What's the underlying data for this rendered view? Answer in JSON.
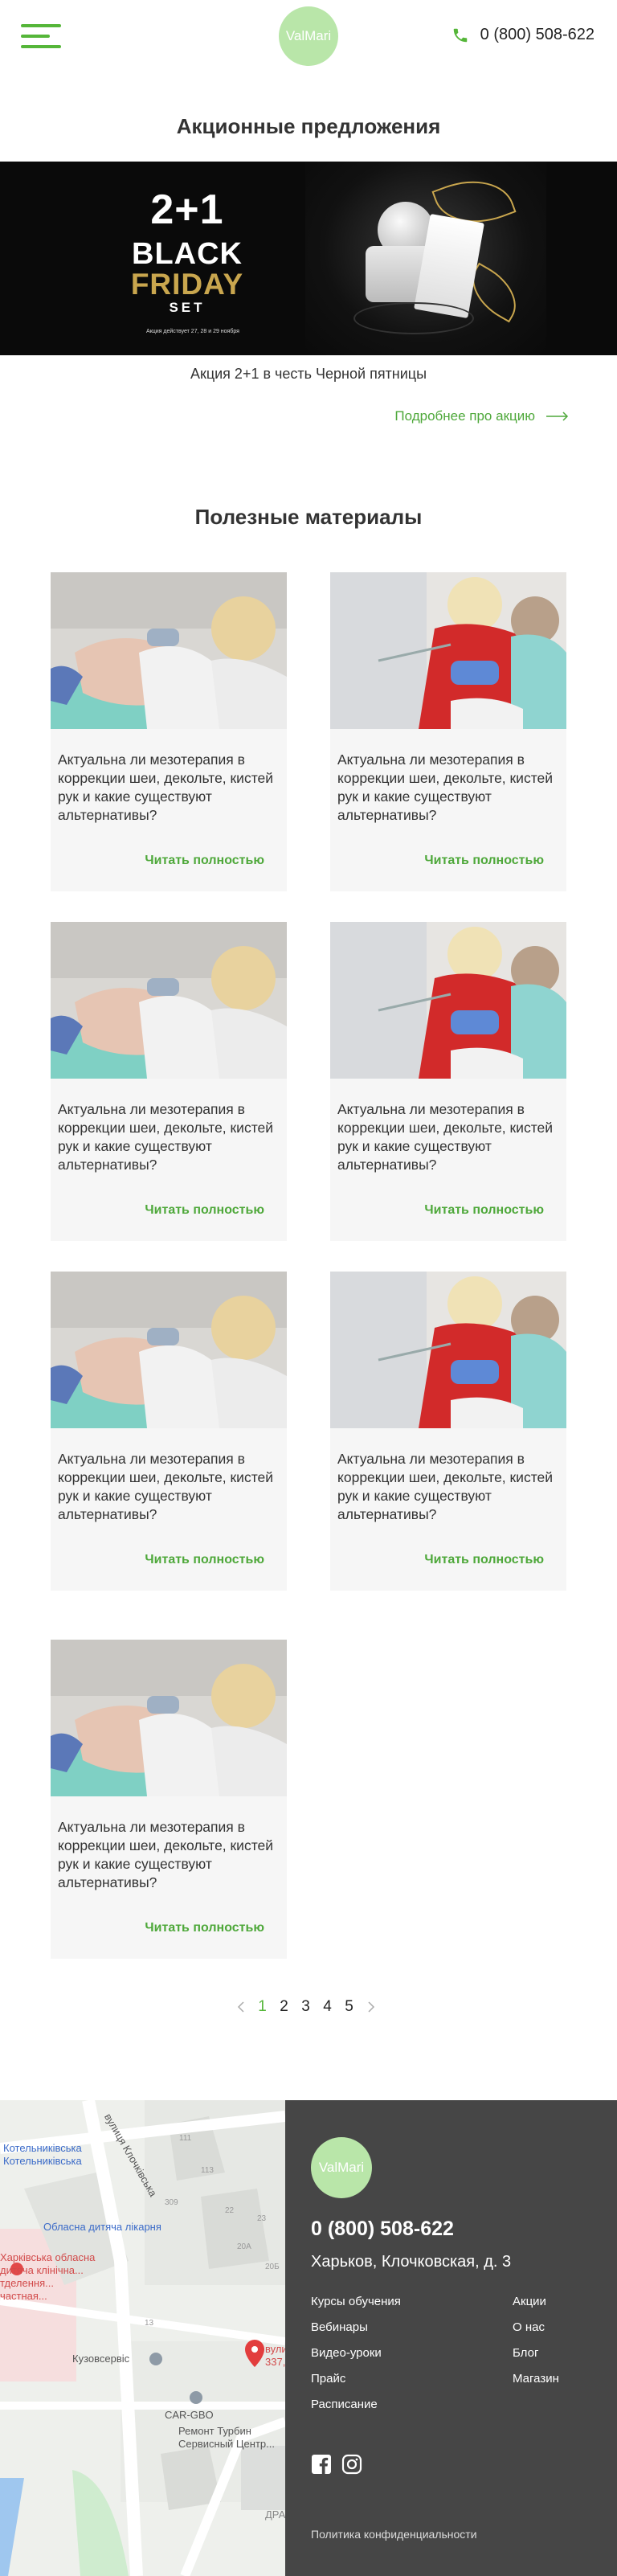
{
  "header": {
    "logo_text": "ValMari",
    "phone": "0 (800) 508-622",
    "accent_color": "#55b639"
  },
  "promo": {
    "title": "Акционные предложения",
    "banner": {
      "line1": "2+1",
      "line2": "BLACK",
      "line3": "FRIDAY",
      "line4": "SET",
      "small": "Акция действует 27, 28 и 29 ноября"
    },
    "caption": "Акция 2+1 в честь Черной пятницы",
    "link_label": "Подробнее про акцию"
  },
  "materials": {
    "title": "Полезные материалы",
    "cards": [
      {
        "text": "Актуальна ли мезотерапия в коррекции шеи, декольте, кистей рук и какие существуют альтернативы?",
        "link": "Читать полностью"
      },
      {
        "text": "Актуальна ли мезотерапия в коррекции шеи, декольте, кистей рук и какие существуют альтернативы?",
        "link": "Читать полностью"
      },
      {
        "text": "Актуальна ли мезотерапия в коррекции шеи, декольте, кистей рук и какие существуют альтернативы?",
        "link": "Читать полностью"
      },
      {
        "text": "Актуальна ли мезотерапия в коррекции шеи, декольте, кистей рук и какие существуют альтернативы?",
        "link": "Читать полностью"
      },
      {
        "text": "Актуальна ли мезотерапия в коррекции шеи, декольте, кистей рук и какие существуют альтернативы?",
        "link": "Читать полностью"
      },
      {
        "text": "Актуальна ли мезотерапия в коррекции шеи, декольте, кистей рук и какие существуют альтернативы?",
        "link": "Читать полностью"
      },
      {
        "text": "Актуальна ли мезотерапия в коррекции шеи, декольте, кистей рук и какие существуют альтернативы?",
        "link": "Читать полностью"
      }
    ]
  },
  "pagination": {
    "pages": [
      "1",
      "2",
      "3",
      "4",
      "5"
    ],
    "current": "1"
  },
  "map": {
    "labels": [
      "вулиця Клочківська",
      "Котельниківська",
      "Котельниківська",
      "Обласна дитяча лікарня",
      "Харківська обласна",
      "дитяча клінічна...",
      "тделення...",
      "частная...",
      "Кузовсервіс",
      "CAR-GBO",
      "Ремонт Турбин",
      "Сервисный Центр...",
      "вули",
      "337,",
      "ДРА"
    ],
    "numbers": [
      "111",
      "113",
      "309",
      "22",
      "23",
      "20А",
      "20Б",
      "13"
    ]
  },
  "footer": {
    "logo_text": "ValMari",
    "phone": "0 (800) 508-622",
    "address": "Харьков, Клочковская, д. 3",
    "menu_left": [
      "Курсы обучения",
      "Вебинары",
      "Видео-уроки",
      "Прайс",
      "Расписание"
    ],
    "menu_right": [
      "Акции",
      "О нас",
      "Блог",
      "Магазин"
    ],
    "social": [
      "facebook-icon",
      "instagram-icon"
    ],
    "policy": "Политика конфиденциальности",
    "background": "#464646"
  }
}
